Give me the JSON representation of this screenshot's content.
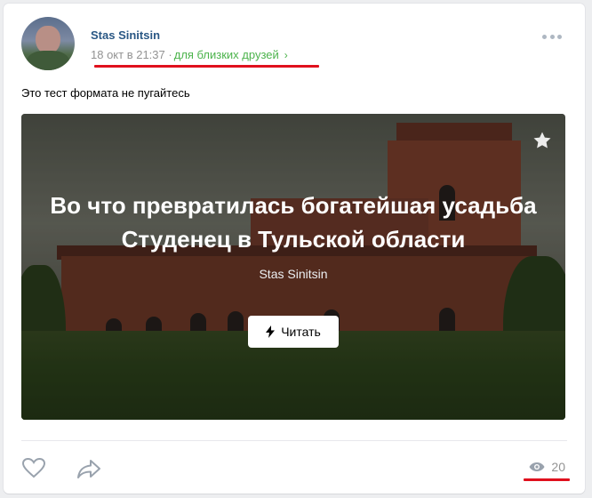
{
  "post": {
    "author": "Stas Sinitsin",
    "date": "18 окт в 21:37",
    "separator": "·",
    "privacy": "для близких друзей",
    "text": "Это тест формата не пугайтесь"
  },
  "article": {
    "title": "Во что превратилась богатейшая усадьба Студенец в Тульской области",
    "author": "Stas Sinitsin",
    "read_label": "Читать"
  },
  "footer": {
    "views": "20"
  },
  "colors": {
    "link": "#2a5885",
    "privacy": "#4bb34b",
    "annotation": "#e0101d"
  },
  "icons": [
    "avatar",
    "more-icon",
    "star-icon",
    "bolt-icon",
    "like-icon",
    "share-icon",
    "eye-icon"
  ]
}
